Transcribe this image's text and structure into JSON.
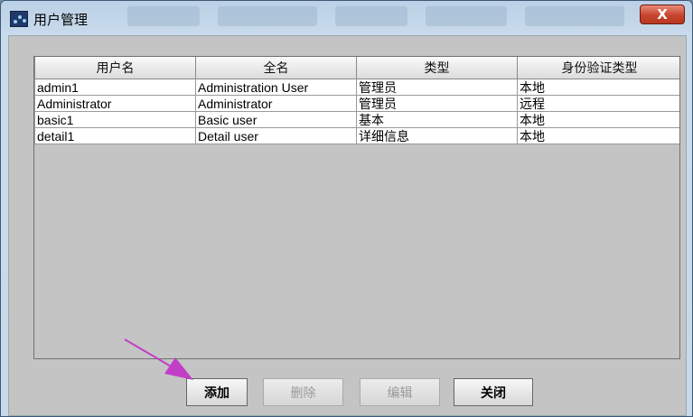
{
  "window": {
    "title": "用户管理",
    "close_label": "X"
  },
  "table": {
    "columns": [
      "用户名",
      "全名",
      "类型",
      "身份验证类型"
    ],
    "rows": [
      [
        "admin1",
        "Administration User",
        "管理员",
        "本地"
      ],
      [
        "Administrator",
        "Administrator",
        "管理员",
        "远程"
      ],
      [
        "basic1",
        "Basic user",
        "基本",
        "本地"
      ],
      [
        "detail1",
        "Detail user",
        "详细信息",
        "本地"
      ]
    ]
  },
  "buttons": {
    "add": "添加",
    "delete": "删除",
    "edit": "编辑",
    "close": "关闭"
  },
  "colors": {
    "annotation_arrow": "#c23ec7"
  }
}
